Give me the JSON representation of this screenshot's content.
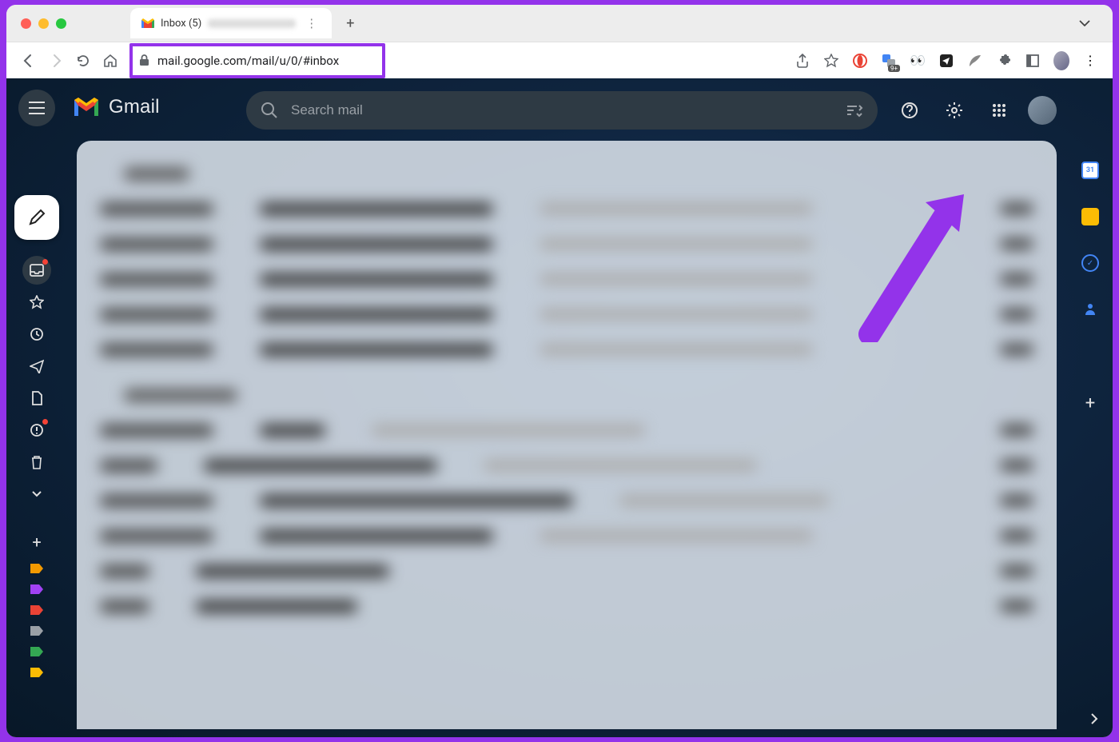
{
  "browser": {
    "tab_title": "Inbox (5)",
    "url": "mail.google.com/mail/u/0/#inbox"
  },
  "gmail": {
    "brand": "Gmail",
    "search_placeholder": "Search mail"
  },
  "annotation": {
    "highlight_color": "#9333ea",
    "arrow_target": "settings-icon"
  },
  "sidebar": {
    "labels": [
      {
        "color": "#f29900"
      },
      {
        "color": "#a142f4"
      },
      {
        "color": "#ea4335"
      },
      {
        "color": "#9aa0a6"
      },
      {
        "color": "#34a853"
      },
      {
        "color": "#fbbc04"
      }
    ]
  }
}
